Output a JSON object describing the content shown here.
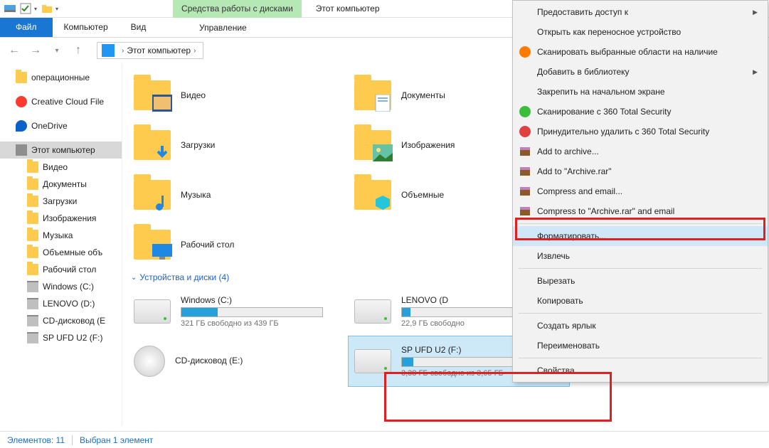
{
  "title": {
    "contextual": "Средства работы с дисками",
    "window": "Этот компьютер"
  },
  "ribbon": {
    "file": "Файл",
    "computer": "Компьютер",
    "view": "Вид",
    "manage": "Управление"
  },
  "breadcrumb": {
    "root": "Этот компьютер"
  },
  "sidebar": {
    "items": [
      {
        "label": "операционные",
        "icon": "folder"
      },
      {
        "label": "Creative Cloud File",
        "icon": "cc"
      },
      {
        "label": "OneDrive",
        "icon": "onedrive"
      },
      {
        "label": "Этот компьютер",
        "icon": "pc",
        "selected": true
      },
      {
        "label": "Видео",
        "icon": "folder",
        "child": true
      },
      {
        "label": "Документы",
        "icon": "folder",
        "child": true
      },
      {
        "label": "Загрузки",
        "icon": "folder",
        "child": true
      },
      {
        "label": "Изображения",
        "icon": "folder",
        "child": true
      },
      {
        "label": "Музыка",
        "icon": "folder",
        "child": true
      },
      {
        "label": "Объемные объ",
        "icon": "folder",
        "child": true
      },
      {
        "label": "Рабочий стол",
        "icon": "folder",
        "child": true
      },
      {
        "label": "Windows (C:)",
        "icon": "drive",
        "child": true
      },
      {
        "label": "LENOVO (D:)",
        "icon": "drive",
        "child": true
      },
      {
        "label": "CD-дисковод (E",
        "icon": "drive",
        "child": true
      },
      {
        "label": "SP UFD U2 (F:)",
        "icon": "drive",
        "child": true
      }
    ]
  },
  "content": {
    "folders": [
      {
        "label": "Видео",
        "overlay": "film"
      },
      {
        "label": "Документы",
        "overlay": "doc"
      },
      {
        "label": "Загрузки",
        "overlay": "download"
      },
      {
        "label": "Изображения",
        "overlay": "image"
      },
      {
        "label": "Музыка",
        "overlay": "music"
      },
      {
        "label": "Объемные",
        "overlay": "cube"
      },
      {
        "label": "Рабочий стол",
        "overlay": "desktop"
      }
    ],
    "devices_header": "Устройства и диски (4)",
    "drives": [
      {
        "name": "Windows (C:)",
        "free": "321 ГБ свободно из 439 ГБ",
        "fill": 26
      },
      {
        "name": "LENOVO (D",
        "free": "22,9 ГБ свободно",
        "fill": 6
      },
      {
        "name": "CD-дисковод (E:)",
        "free": "",
        "fill": 0,
        "cd": true
      },
      {
        "name": "SP UFD U2 (F:)",
        "free": "3,38 ГБ свободно из 3,65 ГБ",
        "fill": 8,
        "selected": true
      }
    ]
  },
  "ctx": {
    "items": [
      {
        "label": "Предоставить доступ к",
        "sub": true
      },
      {
        "label": "Открыть как переносное устройство"
      },
      {
        "label": "Сканировать выбранные области на наличие",
        "icon": "avast"
      },
      {
        "label": "Добавить в библиотеку",
        "sub": true
      },
      {
        "label": "Закрепить на начальном экране"
      },
      {
        "label": "Сканирование с 360 Total Security",
        "icon": "360g"
      },
      {
        "label": "Принудительно удалить с  360 Total Security",
        "icon": "360r"
      },
      {
        "label": "Add to archive...",
        "icon": "rar"
      },
      {
        "label": "Add to \"Archive.rar\"",
        "icon": "rar"
      },
      {
        "label": "Compress and email...",
        "icon": "rar"
      },
      {
        "label": "Compress to \"Archive.rar\" and email",
        "icon": "rar"
      },
      {
        "sep": true
      },
      {
        "label": "Форматировать...",
        "hover": true
      },
      {
        "label": "Извлечь"
      },
      {
        "sep": true
      },
      {
        "label": "Вырезать"
      },
      {
        "label": "Копировать"
      },
      {
        "sep": true
      },
      {
        "label": "Создать ярлык"
      },
      {
        "label": "Переименовать"
      },
      {
        "sep": true
      },
      {
        "label": "Свойства"
      }
    ]
  },
  "status": {
    "count": "Элементов: 11",
    "selected": "Выбран 1 элемент"
  }
}
